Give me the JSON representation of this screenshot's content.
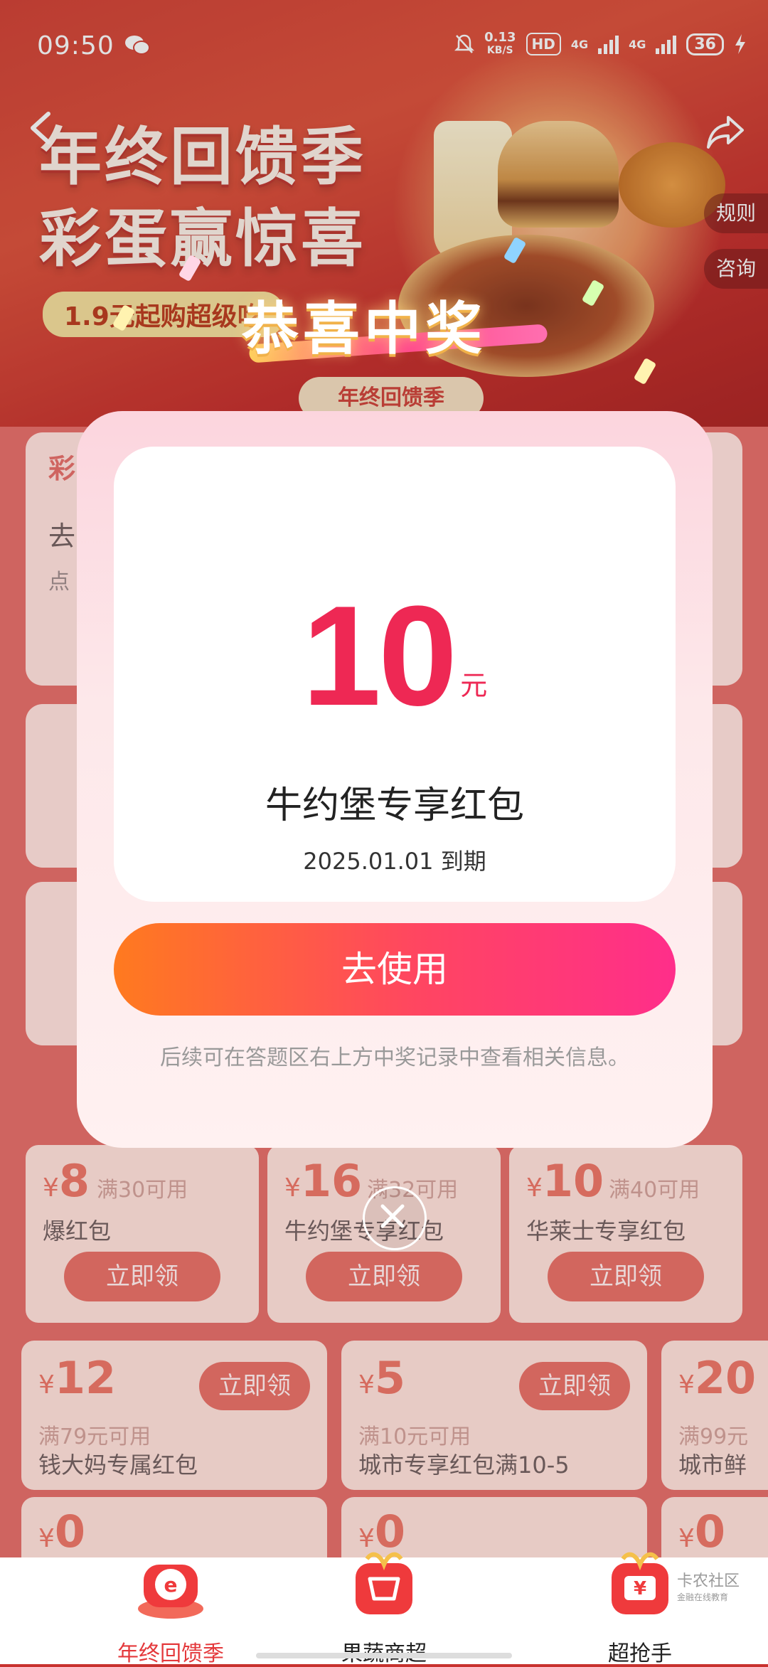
{
  "status_bar": {
    "time": "09:50",
    "net_speed_value": "0.13",
    "net_speed_unit": "KB/S",
    "hd_badge": "HD",
    "network_1": "4G",
    "network_2": "4G",
    "battery": "36"
  },
  "hero": {
    "title_line1": "年终回馈季",
    "title_line2": "彩蛋赢惊喜",
    "subtitle": "1.9元起购超级吃",
    "footer_label": "年终回馈季"
  },
  "side_tags": {
    "rules": "规则",
    "consult": "咨询"
  },
  "background_cards": {
    "card1_title": "去",
    "card1_sub": "点",
    "section_title": "彩"
  },
  "coupons_row1": [
    {
      "currency": "¥",
      "amount": "8",
      "condition": "满30可用",
      "name": "爆红包",
      "button": "立即领"
    },
    {
      "currency": "¥",
      "amount": "16",
      "condition": "满32可用",
      "name": "牛约堡专享红包",
      "button": "立即领"
    },
    {
      "currency": "¥",
      "amount": "10",
      "condition": "满40可用",
      "name": "华莱士专享红包",
      "button": "立即领"
    }
  ],
  "coupons_row2": [
    {
      "currency": "¥",
      "amount": "12",
      "condition": "满79元可用",
      "name": "钱大妈专属红包",
      "button": "立即领"
    },
    {
      "currency": "¥",
      "amount": "5",
      "condition": "满10元可用",
      "name": "城市专享红包满10-5",
      "button": "立即领"
    },
    {
      "currency": "¥",
      "amount": "20",
      "condition": "满99元",
      "name": "城市鲜"
    }
  ],
  "coupons_row3": [
    {
      "currency": "¥",
      "amount": "0"
    },
    {
      "currency": "¥",
      "amount": "0"
    },
    {
      "currency": "¥",
      "amount": "0"
    }
  ],
  "modal": {
    "congrats": "恭喜中奖",
    "amount": "10",
    "unit": "元",
    "prize_name": "牛约堡专享红包",
    "expiry": "2025.01.01 到期",
    "use_button": "去使用",
    "note": "后续可在答题区右上方中奖记录中查看相关信息。"
  },
  "bottom_nav": [
    {
      "label": "年终回馈季",
      "active": true
    },
    {
      "label": "果蔬商超",
      "active": false
    },
    {
      "label": "超抢手",
      "active": false
    }
  ],
  "watermark": {
    "title": "卡农社区",
    "subtitle": "金融在线教育"
  },
  "colors": {
    "accent": "#ee2854",
    "brand_red": "#d2362f",
    "button_gradient_start": "#ff7a1f",
    "button_gradient_end": "#ff2e8a"
  }
}
